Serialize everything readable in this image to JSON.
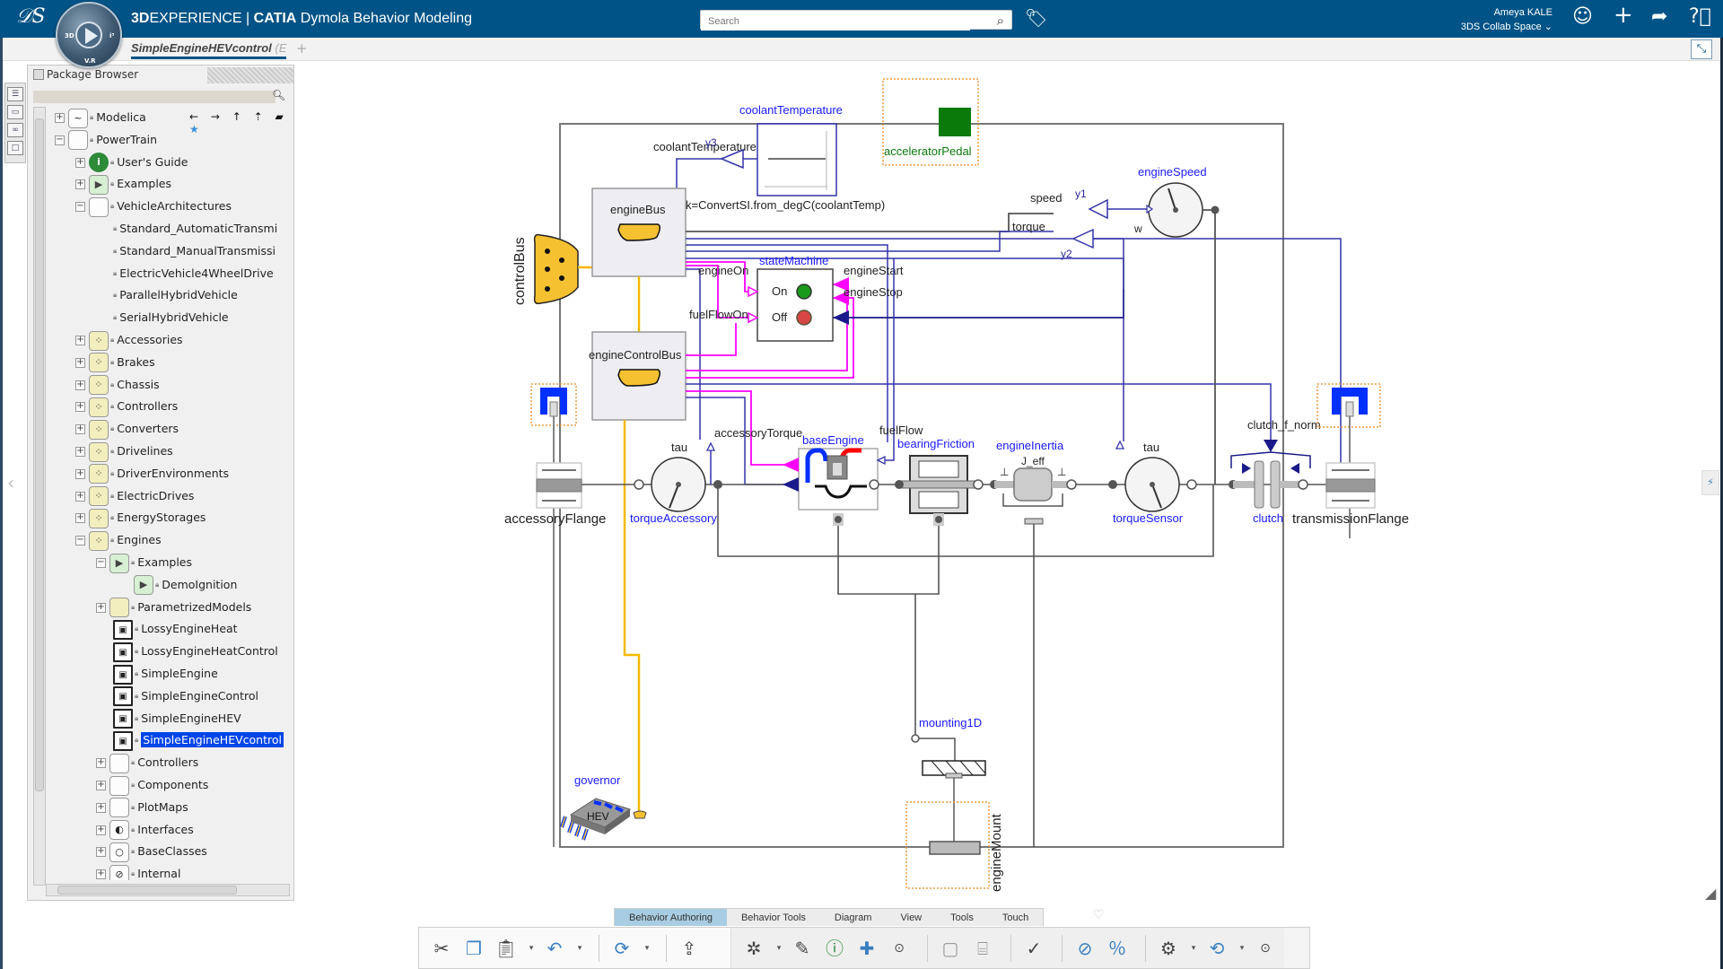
{
  "topbar": {
    "brand_prefix": "3D",
    "brand_mid": "EXPERIENCE | ",
    "brand_catia": "CATIA",
    "brand_app": " Dymola Behavior Modeling",
    "search_placeholder": "Search",
    "user_name": "Ameya KALE",
    "collab_space": "3DS Collab Space",
    "compass_labels": {
      "left": "3D",
      "bottom": "V.R",
      "right": "i³"
    }
  },
  "tabs": {
    "active_doc": "SimpleEngineHEVcontrol",
    "active_doc_suffix": " (E",
    "add": "+"
  },
  "package_browser": {
    "title": "Package Browser",
    "tree": [
      {
        "label": "Modelica",
        "level": 0,
        "expander": "+",
        "icon": "modelica"
      },
      {
        "label": "PowerTrain",
        "level": 0,
        "expander": "-",
        "icon": "package-plain"
      },
      {
        "label": "User's Guide",
        "level": 1,
        "expander": "+",
        "icon": "info"
      },
      {
        "label": "Examples",
        "level": 1,
        "expander": "+",
        "icon": "examples"
      },
      {
        "label": "VehicleArchitectures",
        "level": 1,
        "expander": "-",
        "icon": "package-plain"
      },
      {
        "label": "Standard_AutomaticTransmi",
        "level": 2,
        "expander": "",
        "icon": "none"
      },
      {
        "label": "Standard_ManualTransmissi",
        "level": 2,
        "expander": "",
        "icon": "none"
      },
      {
        "label": "ElectricVehicle4WheelDrive",
        "level": 2,
        "expander": "",
        "icon": "none"
      },
      {
        "label": "ParallelHybridVehicle",
        "level": 2,
        "expander": "",
        "icon": "none"
      },
      {
        "label": "SerialHybridVehicle",
        "level": 2,
        "expander": "",
        "icon": "none"
      },
      {
        "label": "Accessories",
        "level": 1,
        "expander": "+",
        "icon": "package-dots"
      },
      {
        "label": "Brakes",
        "level": 1,
        "expander": "+",
        "icon": "package-dots"
      },
      {
        "label": "Chassis",
        "level": 1,
        "expander": "+",
        "icon": "package-dots"
      },
      {
        "label": "Controllers",
        "level": 1,
        "expander": "+",
        "icon": "package-dots"
      },
      {
        "label": "Converters",
        "level": 1,
        "expander": "+",
        "icon": "package-dots"
      },
      {
        "label": "Drivelines",
        "level": 1,
        "expander": "+",
        "icon": "package-dots"
      },
      {
        "label": "DriverEnvironments",
        "level": 1,
        "expander": "+",
        "icon": "package-dots"
      },
      {
        "label": "ElectricDrives",
        "level": 1,
        "expander": "+",
        "icon": "package-dots"
      },
      {
        "label": "EnergyStorages",
        "level": 1,
        "expander": "+",
        "icon": "package-dots"
      },
      {
        "label": "Engines",
        "level": 1,
        "expander": "-",
        "icon": "package-dots"
      },
      {
        "label": "Examples",
        "level": 2,
        "expander": "-",
        "icon": "examples"
      },
      {
        "label": "DemoIgnition",
        "level": 3,
        "expander": "",
        "icon": "example-run"
      },
      {
        "label": "ParametrizedModels",
        "level": 2,
        "expander": "+",
        "icon": "param"
      },
      {
        "label": "LossyEngineHeat",
        "level": 2,
        "expander": "",
        "icon": "engine-model"
      },
      {
        "label": "LossyEngineHeatControl",
        "level": 2,
        "expander": "",
        "icon": "engine-model"
      },
      {
        "label": "SimpleEngine",
        "level": 2,
        "expander": "",
        "icon": "engine-model"
      },
      {
        "label": "SimpleEngineControl",
        "level": 2,
        "expander": "",
        "icon": "engine-model"
      },
      {
        "label": "SimpleEngineHEV",
        "level": 2,
        "expander": "",
        "icon": "engine-model"
      },
      {
        "label": "SimpleEngineHEVcontrol",
        "level": 2,
        "expander": "",
        "icon": "engine-model",
        "selected": true
      },
      {
        "label": "Controllers",
        "level": 2,
        "expander": "+",
        "icon": "package-plain"
      },
      {
        "label": "Components",
        "level": 2,
        "expander": "+",
        "icon": "package-plain"
      },
      {
        "label": "PlotMaps",
        "level": 2,
        "expander": "+",
        "icon": "package-plain"
      },
      {
        "label": "Interfaces",
        "level": 2,
        "expander": "+",
        "icon": "interfaces"
      },
      {
        "label": "BaseClasses",
        "level": 2,
        "expander": "+",
        "icon": "baseclasses"
      },
      {
        "label": "Internal",
        "level": 2,
        "expander": "+",
        "icon": "internal"
      }
    ],
    "nav_arrows": "← → ↑"
  },
  "diagram": {
    "labels": {
      "coolantTemperature_block": "coolantTemperature",
      "coolantTemperature_sig": "coolantTemperature",
      "y3": "y3",
      "k_expr": "k=ConvertSI.from_degC(coolantTemp)",
      "acceleratorPedal": "acceleratorPedal",
      "engineBus": "engineBus",
      "controlBus": "controlBus",
      "engineSpeed": "engineSpeed",
      "speed": "speed",
      "y1": "y1",
      "torque": "torque",
      "y2": "y2",
      "w": "w",
      "stateMachine": "stateMachine",
      "engineOn": "engineOn",
      "fuelFlowOn": "fuelFlowOn",
      "engineStart": "engineStart",
      "engineStop": "engineStop",
      "on": "On",
      "off": "Off",
      "engineControlBus": "engineControlBus",
      "accessoryTorque": "accessoryTorque",
      "fuelFlow": "fuelFlow",
      "baseEngine": "baseEngine",
      "bearingFriction": "bearingFriction",
      "engineInertia": "engineInertia",
      "J_eff": "J_eff",
      "tau1": "tau",
      "tau2": "tau",
      "torqueAccessory": "torqueAccessory",
      "torqueSensor": "torqueSensor",
      "clutch_f_norm": "clutch_f_norm",
      "clutch": "clutch",
      "accessoryFlange": "accessoryFlange",
      "transmissionFlange": "transmissionFlange",
      "mounting1D": "mounting1D",
      "engineMount": "engineMount",
      "governor": "governor",
      "HEV": "HEV"
    },
    "colors": {
      "component_name": "#1a1aff",
      "signal_blue": "#2a2a9a",
      "signal_magenta": "#ff00ff",
      "bus_yellow": "#f5b800",
      "mech_gray": "#555555",
      "pedal_green": "#0a7a0a"
    }
  },
  "ribbon": {
    "tabs": [
      "Behavior Authoring",
      "Behavior Tools",
      "Diagram",
      "View",
      "Tools",
      "Touch"
    ],
    "active_tab": "Behavior Authoring"
  }
}
